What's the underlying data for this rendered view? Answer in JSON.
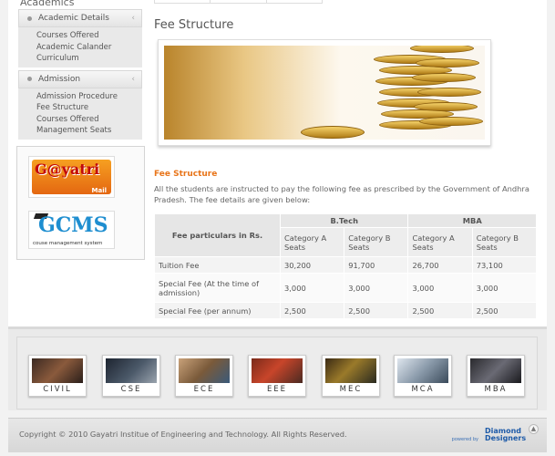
{
  "sidebar": {
    "title": "Academics",
    "sections": [
      {
        "label": "Academic Details",
        "items": [
          "Courses Offered",
          "Academic Calander",
          "Curriculum"
        ]
      },
      {
        "label": "Admission",
        "items": [
          "Admission Procedure",
          "Fee Structure",
          "Courses Offered",
          "Management Seats"
        ]
      }
    ],
    "logos": {
      "gayatri": {
        "text": "G@yatri",
        "sub": "Mail"
      },
      "gcms": {
        "text": "GCMS",
        "sub": "couse management system"
      }
    }
  },
  "main": {
    "title": "Fee Structure",
    "section_title": "Fee Structure",
    "intro": "All the students are instructed to pay the following fee as prescribed by the Government of Andhra Pradesh. The fee details are given below:"
  },
  "fee_table": {
    "header_particulars": "Fee particulars in Rs.",
    "groups": [
      "B.Tech",
      "MBA"
    ],
    "subheaders": [
      "Category A Seats",
      "Category B Seats",
      "Category A Seats",
      "Category B Seats"
    ],
    "rows": [
      {
        "label": "Tuition Fee",
        "values": [
          "30,200",
          "91,700",
          "26,700",
          "73,100"
        ]
      },
      {
        "label": "Special Fee (At the time of admission)",
        "values": [
          "3,000",
          "3,000",
          "3,000",
          "3,000"
        ]
      },
      {
        "label": "Special Fee (per annum)",
        "values": [
          "2,500",
          "2,500",
          "2,500",
          "2,500"
        ]
      }
    ]
  },
  "departments": [
    "CIVIL",
    "CSE",
    "ECE",
    "EEE",
    "MEC",
    "MCA",
    "MBA"
  ],
  "footer": {
    "copyright": "Copyright © 2010 Gayatri Institue of Engineering and Technology. All Rights Reserved.",
    "powered": "powered by",
    "designer": "Diamond Designers"
  }
}
